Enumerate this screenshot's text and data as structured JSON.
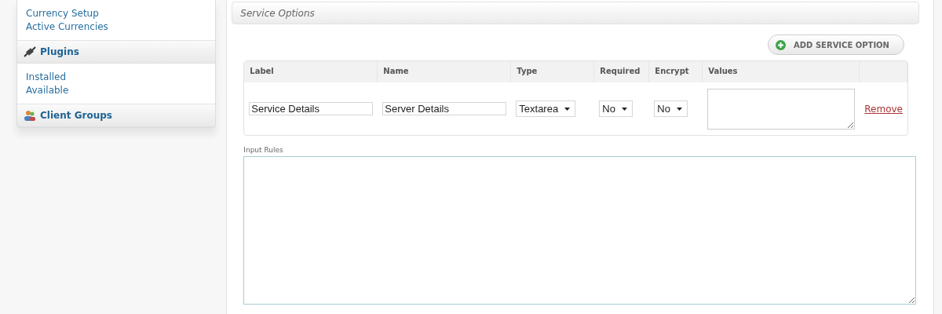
{
  "sidebar": {
    "groups": [
      {
        "items": [
          "Currency Setup",
          "Active Currencies"
        ]
      },
      {
        "title": "Plugins",
        "items": [
          "Installed",
          "Available"
        ]
      },
      {
        "title": "Client Groups"
      }
    ]
  },
  "panel": {
    "title": "Service Options",
    "add_button": "ADD SERVICE OPTION",
    "table": {
      "columns": [
        "Label",
        "Name",
        "Type",
        "Required",
        "Encrypt",
        "Values"
      ],
      "rows": [
        {
          "label": "Service Details",
          "name": "Server Details",
          "type": "Textarea",
          "required": "No",
          "encrypt": "No",
          "remove": "Remove"
        }
      ]
    },
    "input_rules": {
      "label": "Input Rules"
    }
  }
}
